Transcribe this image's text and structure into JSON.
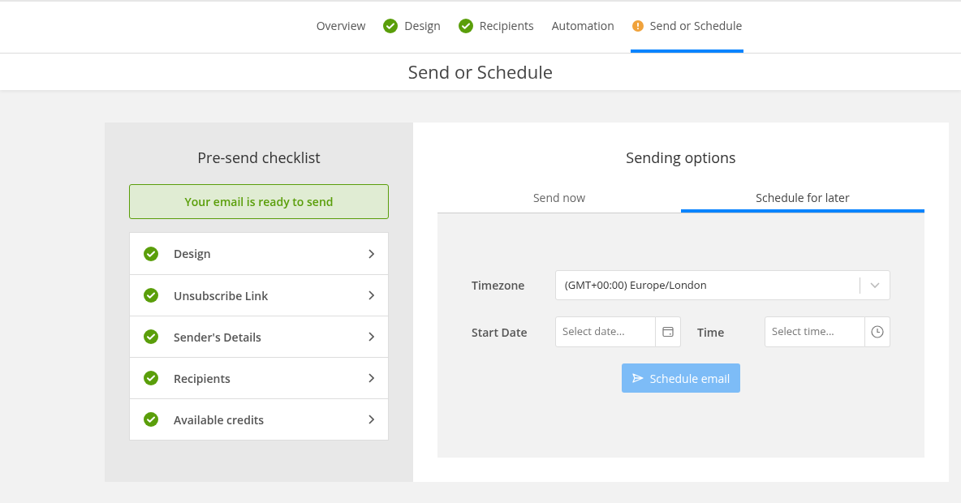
{
  "steps": [
    {
      "label": "Overview",
      "done": false,
      "warning": false,
      "selected": false
    },
    {
      "label": "Design",
      "done": true,
      "warning": false,
      "selected": false
    },
    {
      "label": "Recipients",
      "done": true,
      "warning": false,
      "selected": false
    },
    {
      "label": "Automation",
      "done": false,
      "warning": false,
      "selected": false
    },
    {
      "label": "Send or Schedule",
      "done": false,
      "warning": true,
      "selected": true
    }
  ],
  "page_title": "Send or Schedule",
  "checklist": {
    "title": "Pre-send checklist",
    "status_message": "Your email is ready to send",
    "items": [
      {
        "label": "Design",
        "done": true
      },
      {
        "label": "Unsubscribe Link",
        "done": true
      },
      {
        "label": "Sender's Details",
        "done": true
      },
      {
        "label": "Recipients",
        "done": true
      },
      {
        "label": "Available credits",
        "done": true
      }
    ]
  },
  "sending_options": {
    "title": "Sending options",
    "tabs": [
      {
        "label": "Send now",
        "selected": false
      },
      {
        "label": "Schedule for later",
        "selected": true
      }
    ],
    "timezone": {
      "label": "Timezone",
      "value": "(GMT+00:00) Europe/London"
    },
    "start_date": {
      "label": "Start Date",
      "placeholder": "Select date..."
    },
    "time": {
      "label": "Time",
      "placeholder": "Select time..."
    },
    "button": {
      "label": "Schedule email",
      "disabled": true
    }
  }
}
